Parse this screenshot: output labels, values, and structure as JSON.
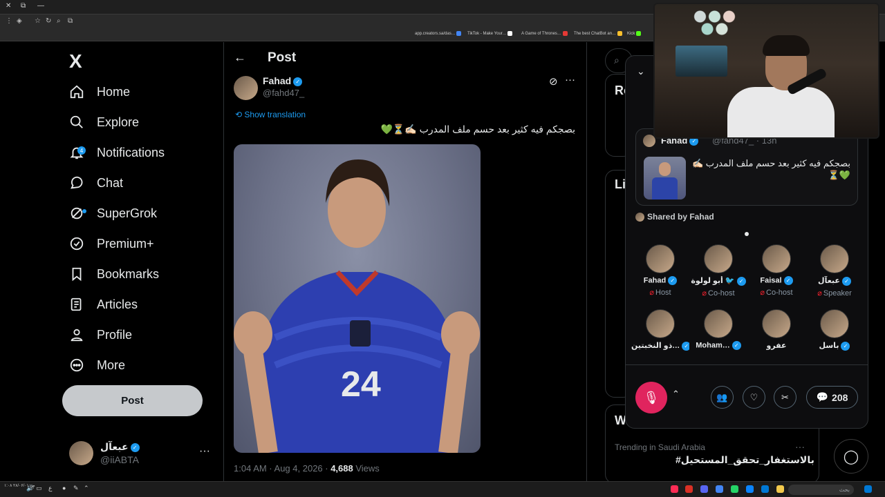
{
  "browser": {
    "bookmarks": [
      {
        "label": "app.creators.sa/das…",
        "color": "#4285f4"
      },
      {
        "label": "TikTok - Make Your…",
        "color": "#ffffff"
      },
      {
        "label": "A Game of Thrones…",
        "color": "#e53935"
      },
      {
        "label": "The best ChatBot an…",
        "color": "#fbc02d"
      },
      {
        "label": "Kick",
        "color": "#53fc18"
      }
    ]
  },
  "sidebar": {
    "logo": "X",
    "items": [
      {
        "label": "Home",
        "icon": "home-icon"
      },
      {
        "label": "Explore",
        "icon": "search-icon"
      },
      {
        "label": "Notifications",
        "icon": "bell-icon",
        "badge": "4"
      },
      {
        "label": "Chat",
        "icon": "chat-icon"
      },
      {
        "label": "SuperGrok",
        "icon": "grok-icon"
      },
      {
        "label": "Premium+",
        "icon": "verified-icon"
      },
      {
        "label": "Bookmarks",
        "icon": "bookmark-icon"
      },
      {
        "label": "Articles",
        "icon": "article-icon"
      },
      {
        "label": "Profile",
        "icon": "person-icon"
      },
      {
        "label": "More",
        "icon": "more-icon"
      }
    ],
    "post_button": "Post",
    "account": {
      "name": "عبعآل",
      "handle": "@iiABTA",
      "more": "···"
    }
  },
  "post": {
    "header": "Post",
    "author": {
      "name": "Fahad",
      "handle": "@fahd47_"
    },
    "show_translation": "Show translation",
    "text": "بصجكم فيه كثير بعد حسم ملف المدرب ✍🏻⏳💚",
    "time": "1:04 AM · Aug 4, 2026 · ",
    "views_count": "4,688",
    "views_label": " Views"
  },
  "right": {
    "frag1": "Ro",
    "frag2": "Li",
    "frag3": "Wh",
    "trend_location": "Trending in Saudi Arabia",
    "trend_topic": "#بالاستغفار_تحقق_المستحيل",
    "trend_more": "···"
  },
  "space": {
    "shared": {
      "name": "Fahad",
      "handle": "@fahd47_ · 13h",
      "text": "بصجكم فيه كثير بعد حسم ملف المدرب ✍🏻 💚⏳"
    },
    "shared_by": "Shared by Fahad",
    "speakers": [
      {
        "name": "Fahad",
        "role": "Host",
        "verified": true
      },
      {
        "name": "أبو لولوة 🐦",
        "role": "Co-host",
        "verified": true
      },
      {
        "name": "Faisal",
        "role": "Co-host",
        "verified": true
      },
      {
        "name": "عبعآل",
        "role": "Speaker",
        "verified": true
      },
      {
        "name": "ذو النخبتين…",
        "role": "",
        "verified": true
      },
      {
        "name": "Moham…",
        "role": "",
        "verified": true
      },
      {
        "name": "عفرو",
        "role": "",
        "verified": false
      },
      {
        "name": "باسل",
        "role": "",
        "verified": true
      }
    ],
    "comments_count": "208"
  },
  "taskbar": {
    "search": "بحث",
    "clock": "۱:۰۸ ص\n۲۸/۰۶/۰۱"
  }
}
